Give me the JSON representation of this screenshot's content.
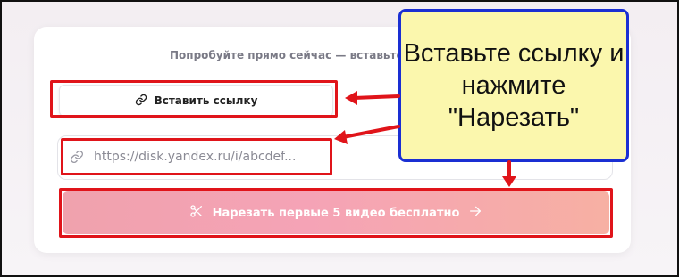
{
  "subtitle": "Попробуйте прямо сейчас — вставьте",
  "paste_button": {
    "label": "Вставить ссылку",
    "icon": "link-icon"
  },
  "url_field": {
    "value": "https://disk.yandex.ru/i/abcdef...",
    "icon": "link-icon"
  },
  "cut_button": {
    "label": "Нарезать первые 5 видео бесплатно",
    "icon_left": "scissors-icon",
    "icon_right": "arrow-right-icon"
  },
  "callout": {
    "text": "Вставьте ссылку и нажмите \"Нарезать\""
  },
  "colors": {
    "highlight": "#e0141a",
    "callout_border": "#1a2fd3",
    "callout_bg": "#fbf7ad",
    "button_gradient_start": "#f0a2ad",
    "button_gradient_end": "#f7b0a3"
  }
}
